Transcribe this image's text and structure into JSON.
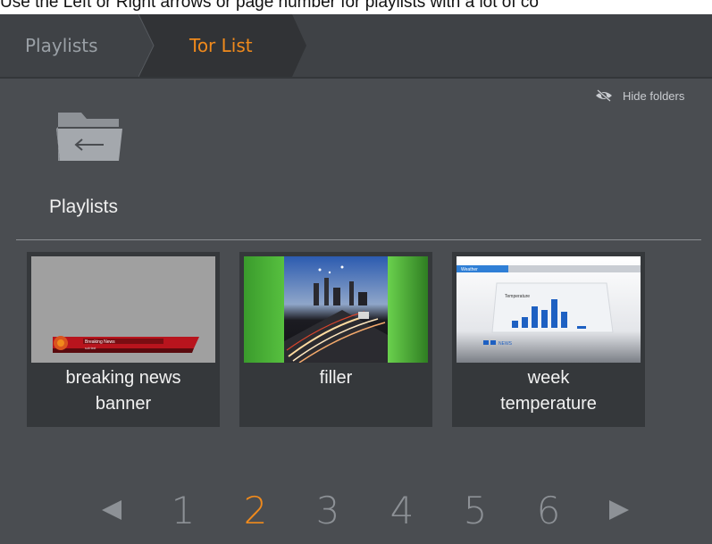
{
  "caption": "Use the Left or Right arrows or page number for playlists with a lot of co",
  "breadcrumb": {
    "items": [
      {
        "label": "Playlists"
      },
      {
        "label": "Tor List"
      }
    ]
  },
  "hide_folders": {
    "label": "Hide folders",
    "icon": "eye-slash-icon"
  },
  "folder": {
    "label": "Playlists",
    "icon": "folder-back-icon"
  },
  "cards": [
    {
      "title_line1": "breaking news",
      "title_line2": "banner",
      "thumb_text1": "Breaking News",
      "thumb_text2": "sub text"
    },
    {
      "title_line1": "filler",
      "title_line2": ""
    },
    {
      "title_line1": "week",
      "title_line2": "temperature",
      "thumb_text1": "Weather",
      "thumb_text2": "Temperature",
      "thumb_text3": "NEWS"
    }
  ],
  "pagination": {
    "pages": [
      "1",
      "2",
      "3",
      "4",
      "5",
      "6"
    ],
    "active": "2"
  },
  "colors": {
    "accent": "#f08a1c",
    "background": "#4a4d51",
    "header": "#3f4246",
    "card": "#35383b"
  }
}
